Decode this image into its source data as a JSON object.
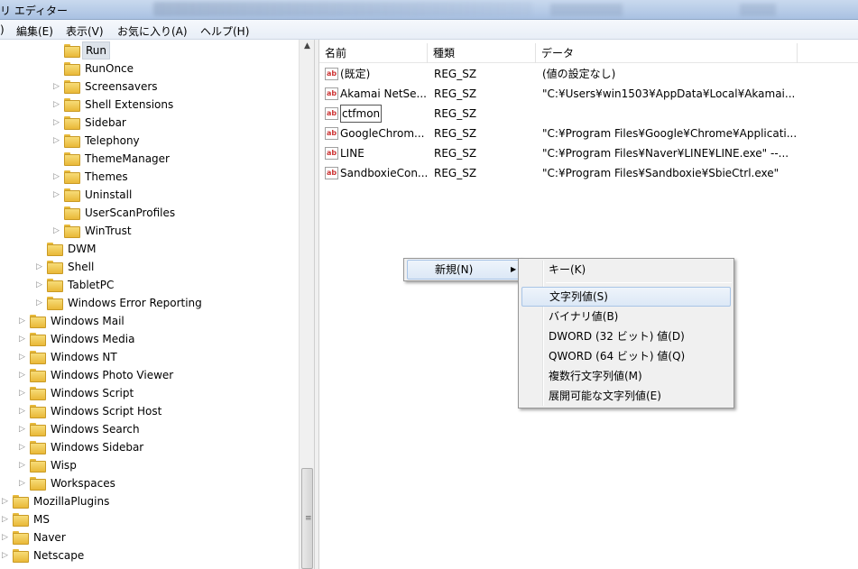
{
  "window": {
    "title": "リ エディター"
  },
  "menu": {
    "file_partial": ")",
    "edit": "編集(E)",
    "view": "表示(V)",
    "favorites": "お気に入り(A)",
    "help": "ヘルプ(H)"
  },
  "tree": {
    "items": [
      {
        "label": "Run",
        "level": 3,
        "arrow": false,
        "selected": true
      },
      {
        "label": "RunOnce",
        "level": 3,
        "arrow": false
      },
      {
        "label": "Screensavers",
        "level": 3,
        "arrow": true
      },
      {
        "label": "Shell Extensions",
        "level": 3,
        "arrow": true
      },
      {
        "label": "Sidebar",
        "level": 3,
        "arrow": true
      },
      {
        "label": "Telephony",
        "level": 3,
        "arrow": true
      },
      {
        "label": "ThemeManager",
        "level": 3,
        "arrow": false
      },
      {
        "label": "Themes",
        "level": 3,
        "arrow": true
      },
      {
        "label": "Uninstall",
        "level": 3,
        "arrow": true
      },
      {
        "label": "UserScanProfiles",
        "level": 3,
        "arrow": false
      },
      {
        "label": "WinTrust",
        "level": 3,
        "arrow": true
      },
      {
        "label": "DWM",
        "level": 2,
        "arrow": false
      },
      {
        "label": "Shell",
        "level": 2,
        "arrow": true
      },
      {
        "label": "TabletPC",
        "level": 2,
        "arrow": true
      },
      {
        "label": "Windows Error Reporting",
        "level": 2,
        "arrow": true
      },
      {
        "label": "Windows Mail",
        "level": 1,
        "arrow": true
      },
      {
        "label": "Windows Media",
        "level": 1,
        "arrow": true
      },
      {
        "label": "Windows NT",
        "level": 1,
        "arrow": true
      },
      {
        "label": "Windows Photo Viewer",
        "level": 1,
        "arrow": true
      },
      {
        "label": "Windows Script",
        "level": 1,
        "arrow": true
      },
      {
        "label": "Windows Script Host",
        "level": 1,
        "arrow": true
      },
      {
        "label": "Windows Search",
        "level": 1,
        "arrow": true
      },
      {
        "label": "Windows Sidebar",
        "level": 1,
        "arrow": true
      },
      {
        "label": "Wisp",
        "level": 1,
        "arrow": true
      },
      {
        "label": "Workspaces",
        "level": 1,
        "arrow": true
      },
      {
        "label": "MozillaPlugins",
        "level": 0,
        "arrow": true
      },
      {
        "label": "MS",
        "level": 0,
        "arrow": true
      },
      {
        "label": "Naver",
        "level": 0,
        "arrow": true
      },
      {
        "label": "Netscape",
        "level": 0,
        "arrow": true
      }
    ]
  },
  "list": {
    "headers": {
      "name": "名前",
      "type": "種類",
      "data": "データ"
    },
    "icon_text": "ab",
    "rows": [
      {
        "name": "(既定)",
        "type": "REG_SZ",
        "data": "(値の設定なし)"
      },
      {
        "name": "Akamai NetSe...",
        "type": "REG_SZ",
        "data": "\"C:¥Users¥win1503¥AppData¥Local¥Akamai..."
      },
      {
        "name": "ctfmon",
        "type": "REG_SZ",
        "data": "",
        "editing": true
      },
      {
        "name": "GoogleChrom...",
        "type": "REG_SZ",
        "data": "\"C:¥Program Files¥Google¥Chrome¥Applicati..."
      },
      {
        "name": "LINE",
        "type": "REG_SZ",
        "data": "\"C:¥Program Files¥Naver¥LINE¥LINE.exe\" --..."
      },
      {
        "name": "SandboxieCon...",
        "type": "REG_SZ",
        "data": "\"C:¥Program Files¥Sandboxie¥SbieCtrl.exe\""
      }
    ]
  },
  "context_menu": {
    "new_label": "新規(N)"
  },
  "new_submenu": {
    "items": [
      {
        "label": "キー(K)"
      },
      {
        "label": "文字列値(S)",
        "highlighted": true
      },
      {
        "label": "バイナリ値(B)"
      },
      {
        "label": "DWORD (32 ビット) 値(D)"
      },
      {
        "label": "QWORD (64 ビット) 値(Q)"
      },
      {
        "label": "複数行文字列値(M)"
      },
      {
        "label": "展開可能な文字列値(E)"
      }
    ]
  }
}
